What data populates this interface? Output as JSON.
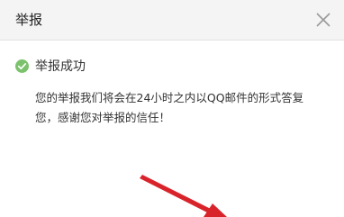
{
  "dialog": {
    "title": "举报",
    "close_icon": "close-icon",
    "status": {
      "icon": "check-circle-icon",
      "icon_color": "#7cc26d",
      "title": "举报成功"
    },
    "message": {
      "line1": "您的举报我们将会在24小时之内以QQ邮件的形式答复",
      "line2": "您，感谢您对举报的信任！"
    }
  },
  "annotation": {
    "color": "#d9232b"
  }
}
